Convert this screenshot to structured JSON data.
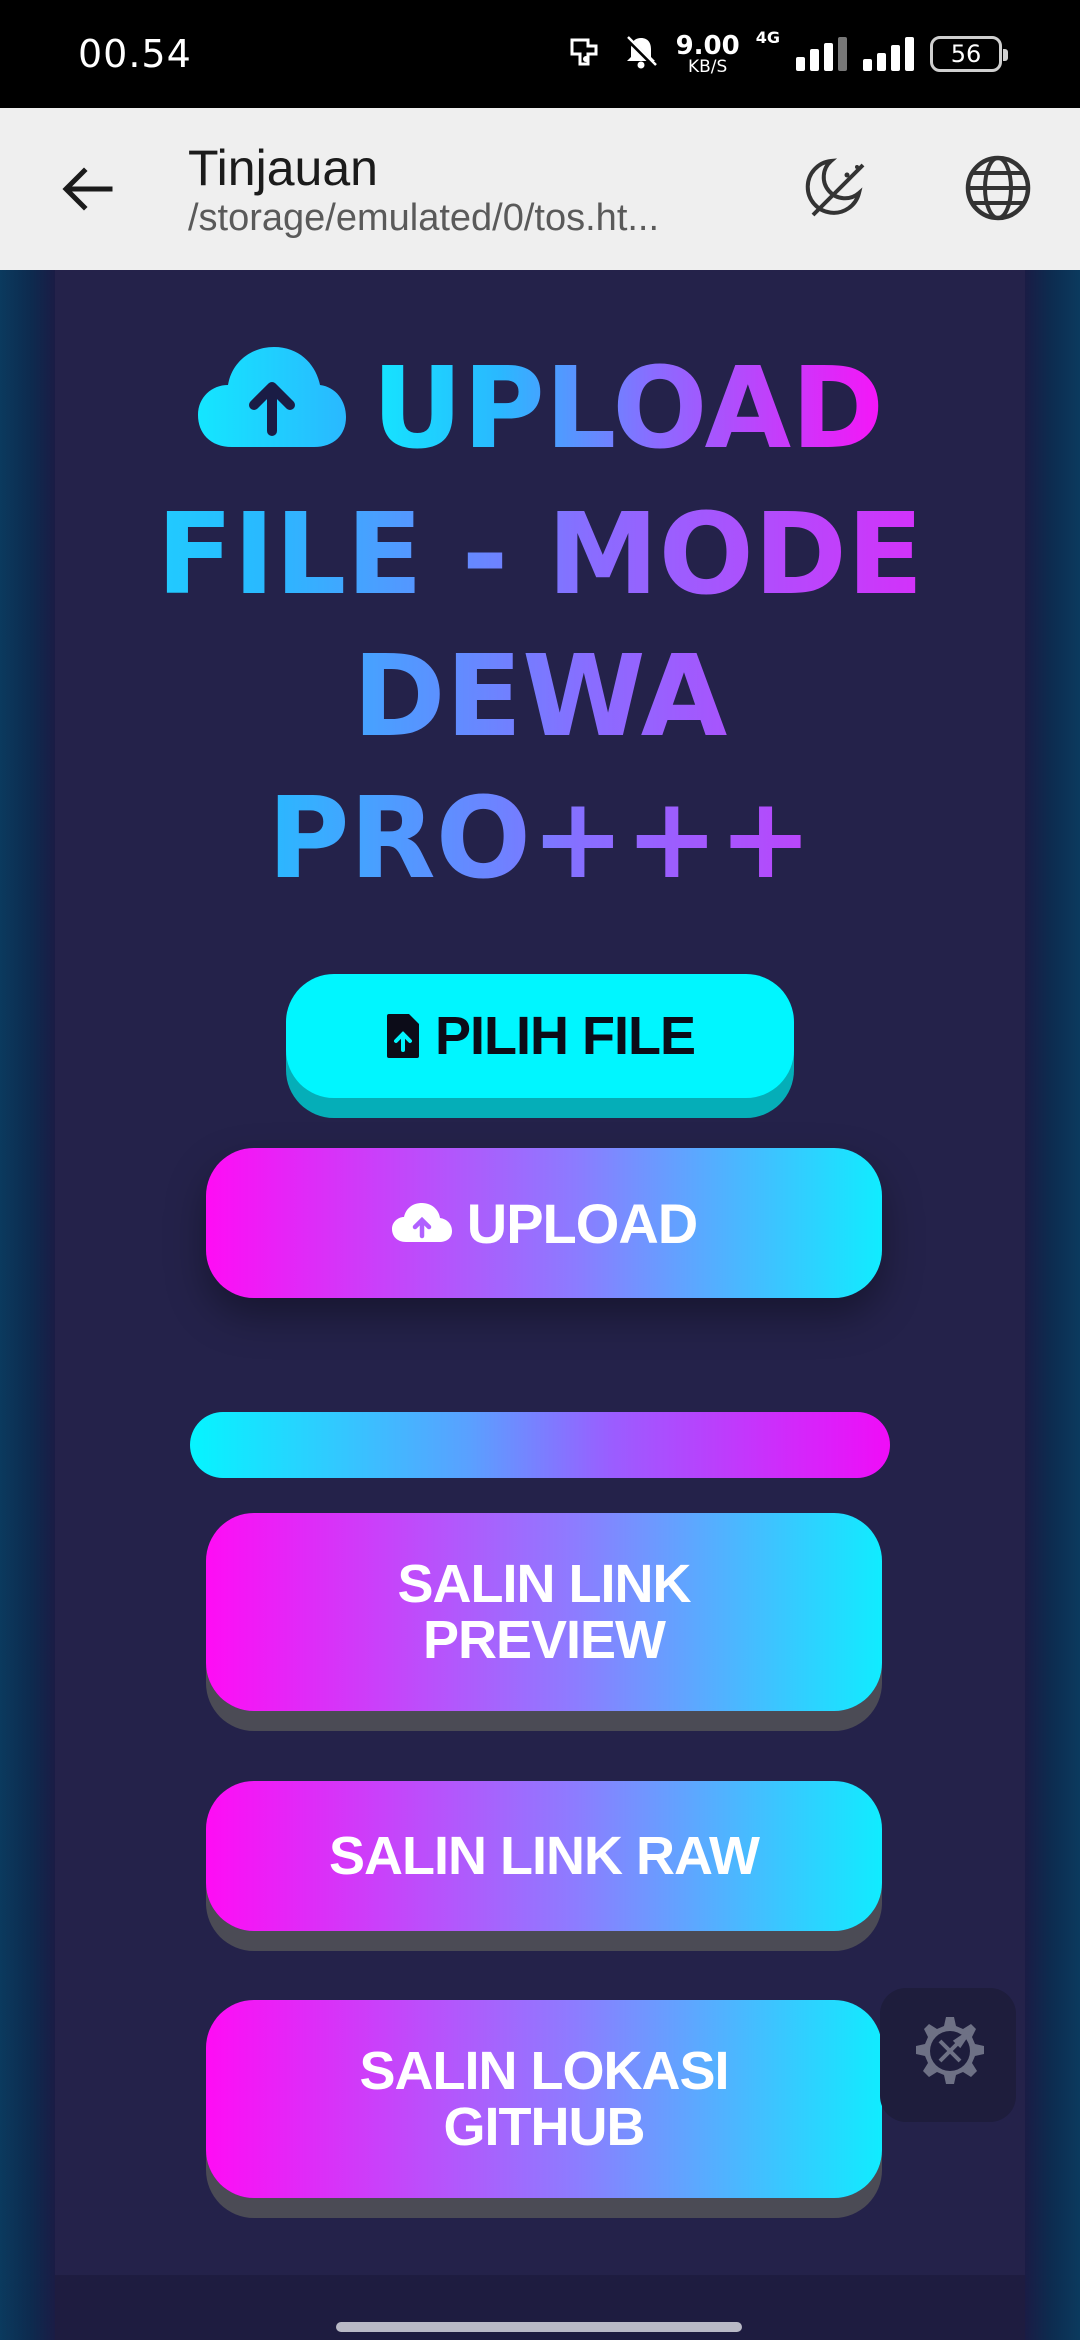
{
  "status_bar": {
    "time": "00.54",
    "net_speed_value": "9.00",
    "net_speed_unit": "KB/S",
    "network_type": "4G",
    "battery": "56"
  },
  "app_bar": {
    "title": "Tinjauan",
    "subtitle": "/storage/emulated/0/tos.ht..."
  },
  "page": {
    "headline_lines": [
      "UPLOAD",
      "FILE - MODE",
      "DEWA",
      "PRO+++"
    ],
    "choose_file_label": "PILIH FILE",
    "upload_label": "UPLOAD",
    "copy_preview_line1": "SALIN LINK",
    "copy_preview_line2": "PREVIEW",
    "copy_raw_label": "SALIN LINK RAW",
    "copy_github_line1": "SALIN LOKASI",
    "copy_github_line2": "GITHUB"
  },
  "colors": {
    "accent_cyan": "#00f6ff",
    "accent_magenta": "#ff0cf5",
    "card_bg": "#24224a"
  }
}
